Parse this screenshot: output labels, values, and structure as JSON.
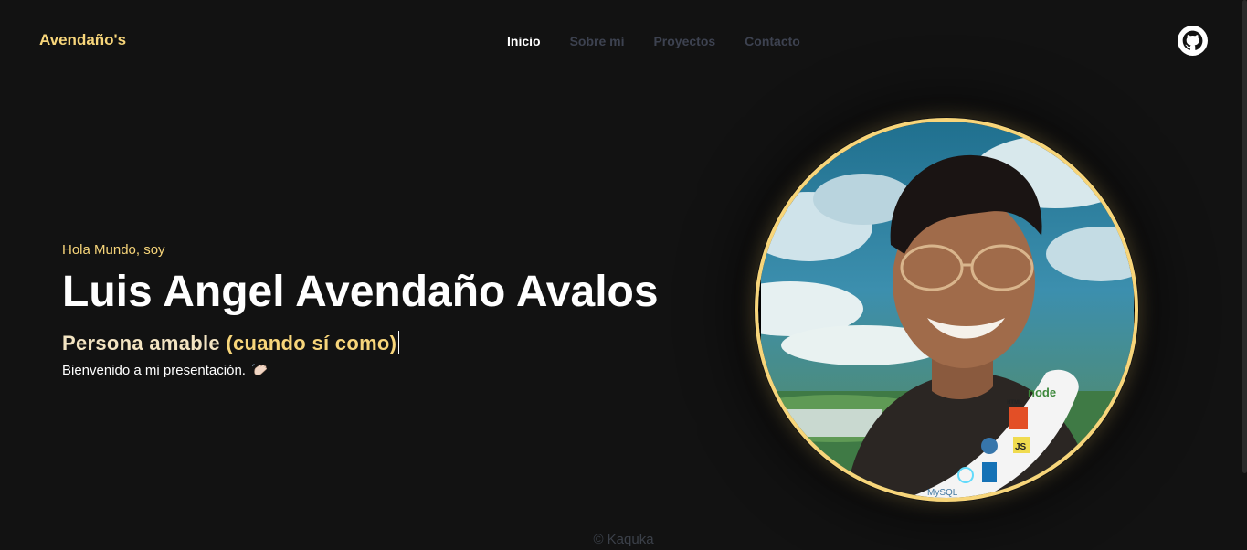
{
  "header": {
    "brand": "Avendaño's",
    "nav": [
      {
        "label": "Inicio",
        "active": true
      },
      {
        "label": "Sobre mí",
        "active": false
      },
      {
        "label": "Proyectos",
        "active": false
      },
      {
        "label": "Contacto",
        "active": false
      }
    ],
    "github_icon": "github-icon"
  },
  "hero": {
    "greeting": "Hola Mundo, soy",
    "name": "Luis Angel Avendaño Avalos",
    "tagline_part1": "Persona amable ",
    "tagline_part2": "(cuando sí como)",
    "welcome": "Bienvenido a mi presentación.",
    "wave_icon": "waving-hand-icon"
  },
  "avatar": {
    "badges": [
      "node",
      "HTML",
      "JS",
      "MySQL"
    ]
  },
  "footer": {
    "text": "© Kaquka"
  },
  "colors": {
    "background": "#121212",
    "accent": "#f7d57a",
    "nav_inactive": "#3d4250"
  }
}
